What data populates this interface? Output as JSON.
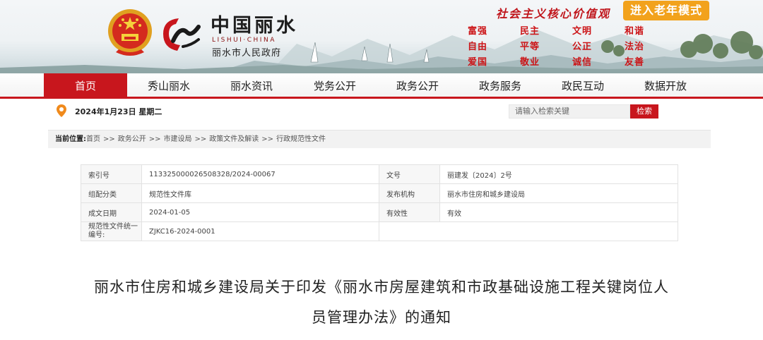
{
  "header": {
    "site_name": "中国丽水",
    "site_pinyin": "LISHUI·CHINA",
    "site_sub": "丽水市人民政府",
    "slogan": "社会主义核心价值观",
    "elder_mode_label": "进入老年模式",
    "core_values": [
      "富强",
      "民主",
      "文明",
      "和谐",
      "自由",
      "平等",
      "公正",
      "法治",
      "爱国",
      "敬业",
      "诚信",
      "友善"
    ],
    "colors": {
      "brand_red": "#c8161d",
      "elder_orange": "#f2a21c"
    }
  },
  "nav": {
    "items": [
      "首页",
      "秀山丽水",
      "丽水资讯",
      "党务公开",
      "政务公开",
      "政务服务",
      "政民互动",
      "数据开放"
    ],
    "active_index": 0
  },
  "toolbar": {
    "date": "2024年1月23日 星期二",
    "search_placeholder": "请输入检索关键",
    "search_label": "检索"
  },
  "breadcrumb": {
    "lead": "当前位置:",
    "items": [
      "首页",
      "政务公开",
      "市建设局",
      "政策文件及解读",
      "行政规范性文件"
    ],
    "separator": ">>"
  },
  "meta": {
    "rows": [
      {
        "k1": "索引号",
        "v1": "113325000026508328/2024-00067",
        "k2": "文号",
        "v2": "丽建发〔2024〕2号"
      },
      {
        "k1": "组配分类",
        "v1": "规范性文件库",
        "k2": "发布机构",
        "v2": "丽水市住房和城乡建设局"
      },
      {
        "k1": "成文日期",
        "v1": "2024-01-05",
        "k2": "有效性",
        "v2": "有效"
      },
      {
        "k1": "规范性文件统一编号:",
        "v1": "ZJKC16-2024-0001",
        "k2": "",
        "v2": ""
      }
    ]
  },
  "document": {
    "title_line1": "丽水市住房和城乡建设局关于印发《丽水市房屋建筑和市政基础设施工程关键岗位人",
    "title_line2": "员管理办法》的通知"
  }
}
